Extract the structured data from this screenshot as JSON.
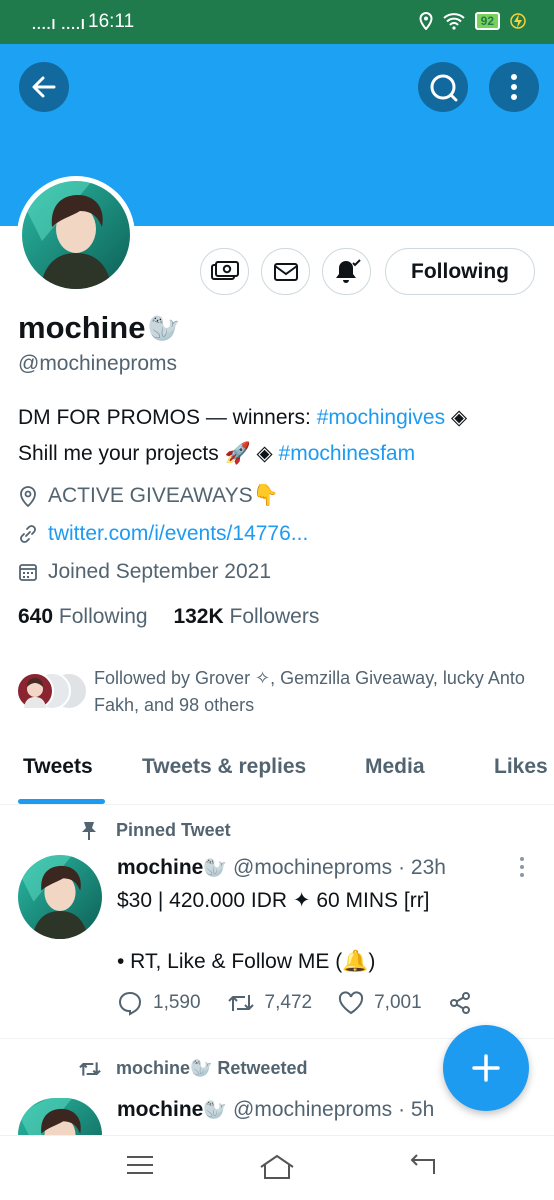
{
  "status_bar": {
    "signal": "....l ....l",
    "time": "16:11",
    "battery": "92"
  },
  "profile": {
    "name": "mochine",
    "name_emoji": "🦭",
    "handle": "@mochineproms",
    "bio_line1_prefix": "DM FOR PROMOS — winners: ",
    "bio_line1_tag": "#mochingives",
    "bio_line1_suffix": " ◈",
    "bio_line2_prefix": "Shill me your projects 🚀 ◈ ",
    "bio_line2_tag": "#mochinesfam",
    "location": "ACTIVE GIVEAWAYS👇",
    "url": "twitter.com/i/events/14776...",
    "joined": "Joined September 2021",
    "following_count": "640",
    "following_label": "Following",
    "followers_count": "132K",
    "followers_label": "Followers",
    "followed_by": "Followed by Grover ✧, Gemzilla Giveaway, lucky Anto Fakh, and 98 others",
    "follow_button": "Following"
  },
  "tabs": [
    {
      "label": "Tweets"
    },
    {
      "label": "Tweets & replies"
    },
    {
      "label": "Media"
    },
    {
      "label": "Likes"
    }
  ],
  "tweet1": {
    "pinned_label": "Pinned Tweet",
    "name": "mochine",
    "name_emoji": "🦭",
    "handle": "@mochineproms",
    "time": "· 23h",
    "line1": "$30 | 420.000 IDR ✦ 60 MINS [rr]",
    "line2": "• RT, Like & Follow ME (🔔)",
    "replies": "1,590",
    "retweets": "7,472",
    "likes": "7,001"
  },
  "tweet2": {
    "retweeted_by": "mochine🦭 Retweeted",
    "name": "mochine",
    "name_emoji": "🦭",
    "handle": "@mochineproms",
    "time": "· 5h"
  },
  "colors": {
    "banner": "#1da1f2",
    "status_bar": "#1f7a4c",
    "accent": "#1d9bf0"
  }
}
